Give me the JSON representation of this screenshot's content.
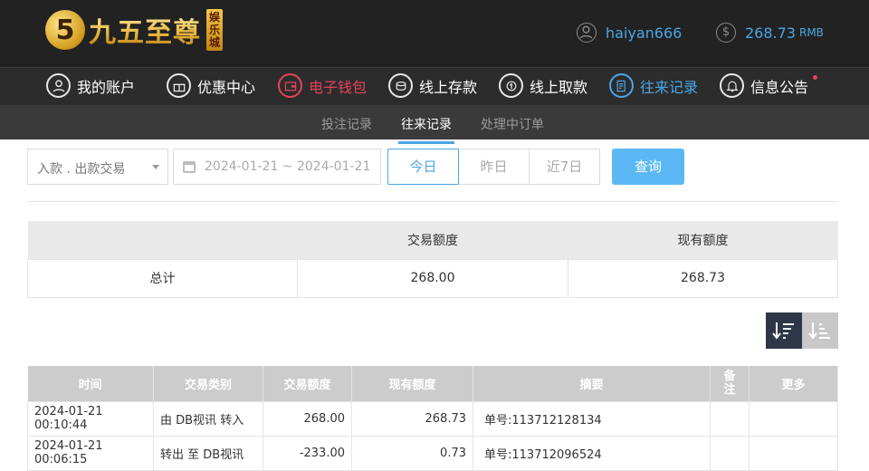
{
  "brand": {
    "logo_glyph": "5",
    "name": "九五至尊",
    "sub": "娱乐城"
  },
  "user": {
    "username": "haiyan666",
    "balance": "268.73",
    "currency": "RMB"
  },
  "nav": [
    {
      "label": "我的账户",
      "icon": "user-icon",
      "state": "normal"
    },
    {
      "label": "优惠中心",
      "icon": "gift-icon",
      "state": "normal"
    },
    {
      "label": "电子钱包",
      "icon": "wallet-icon",
      "state": "red"
    },
    {
      "label": "线上存款",
      "icon": "deposit-icon",
      "state": "normal"
    },
    {
      "label": "线上取款",
      "icon": "withdraw-icon",
      "state": "normal"
    },
    {
      "label": "往来记录",
      "icon": "records-icon",
      "state": "blue"
    },
    {
      "label": "信息公告",
      "icon": "bell-icon",
      "state": "normal"
    }
  ],
  "subtabs": [
    "投注记录",
    "往来记录",
    "处理中订单"
  ],
  "filters": {
    "type_select": "入款 . 出款交易",
    "date_range": "2024-01-21 ~ 2024-01-21",
    "ranges": [
      "今日",
      "昨日",
      "近7日"
    ],
    "query_label": "查询"
  },
  "summary": {
    "headers": [
      "",
      "交易额度",
      "现有额度"
    ],
    "row": [
      "总计",
      "268.00",
      "268.73"
    ]
  },
  "records": {
    "headers": [
      "时间",
      "交易类别",
      "交易额度",
      "现有额度",
      "摘要",
      "备注",
      "更多"
    ],
    "rows": [
      [
        "2024-01-21 00:10:44",
        "由 DB视讯 转入",
        "268.00",
        "268.73",
        "单号:113712128134",
        "",
        ""
      ],
      [
        "2024-01-21 00:06:15",
        "转出 至 DB视讯",
        "-233.00",
        "0.73",
        "单号:113712096524",
        "",
        ""
      ]
    ]
  },
  "colors": {
    "accent": "#4aa6e8",
    "wallet_red": "#e8415b",
    "header_bg": "#222222"
  }
}
